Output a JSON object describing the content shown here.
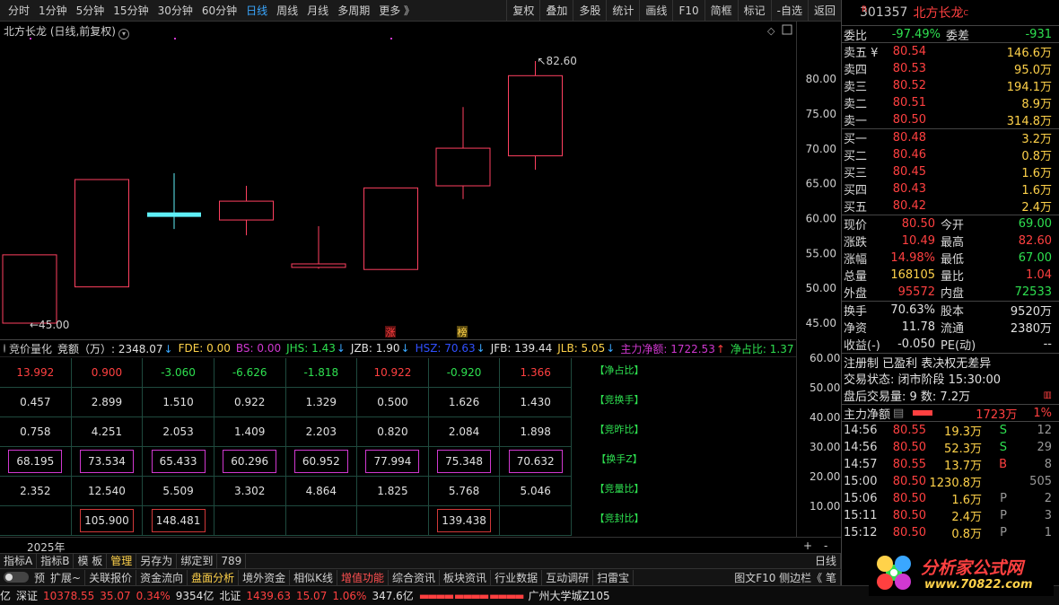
{
  "toolbar": {
    "periods": [
      "分时",
      "1分钟",
      "5分钟",
      "15分钟",
      "30分钟",
      "60分钟",
      "日线",
      "周线",
      "月线",
      "多周期",
      "更多 》"
    ],
    "active_period": "日线",
    "actions": [
      "复权",
      "叠加",
      "多股",
      "统计",
      "画线",
      "F10",
      "简框",
      "标记",
      "-自选",
      "返回"
    ]
  },
  "chart": {
    "title": "北方长龙 (日线,前复权)",
    "high_label": "82.60",
    "low_label": "45.00",
    "price_ticks": [
      "80.00",
      "75.00",
      "70.00",
      "65.00",
      "60.00",
      "55.00",
      "50.00",
      "45.00"
    ],
    "candles": [
      {
        "open": 45.0,
        "close": 54.8,
        "high": 54.8,
        "low": 45.0
      },
      {
        "open": 50.2,
        "close": 65.6,
        "high": 65.6,
        "low": 50.2
      },
      {
        "open": 60.5,
        "close": 60.5,
        "high": 66.5,
        "low": 58.5,
        "kind": "doji"
      },
      {
        "open": 59.8,
        "close": 62.5,
        "high": 64.7,
        "low": 57.6
      },
      {
        "open": 53.0,
        "close": 53.5,
        "high": 58.9,
        "low": 52.8
      },
      {
        "open": 52.7,
        "close": 64.4,
        "high": 64.4,
        "low": 52.7
      },
      {
        "open": 64.7,
        "close": 70.1,
        "high": 76.0,
        "low": 62.8
      },
      {
        "open": 69.0,
        "close": 80.5,
        "high": 82.6,
        "low": 67.0
      }
    ],
    "markers": [
      "涨",
      "榜"
    ]
  },
  "indicator": {
    "name": "竞价量化",
    "fields": [
      {
        "label": "竞额（万）: 2348.07",
        "color": "#e0e0e0",
        "arrow": "↓"
      },
      {
        "label": "FDE: 0.00",
        "color": "#ffd24a",
        "arrow": ""
      },
      {
        "label": "BS: 0.00",
        "color": "#d038d0",
        "arrow": ""
      },
      {
        "label": "JHS: 1.43",
        "color": "#2ee050",
        "arrow": "↓"
      },
      {
        "label": "JZB: 1.90",
        "color": "#e0e0e0",
        "arrow": "↓"
      },
      {
        "label": "HSZ: 70.63",
        "color": "#3050ff",
        "arrow": "↓"
      },
      {
        "label": "JFB: 139.44",
        "color": "#e0e0e0",
        "arrow": ""
      },
      {
        "label": "JLB: 5.05",
        "color": "#ffd24a",
        "arrow": "↓"
      },
      {
        "label": "主力净额: 1722.53",
        "color": "#d038d0",
        "arrow": "↑"
      },
      {
        "label": "净占比: 1.37",
        "color": "#2ee050",
        "arrow": "↑"
      }
    ],
    "rows": [
      {
        "label": "【净占比】",
        "values": [
          "13.992",
          "0.900",
          "-3.060",
          "-6.626",
          "-1.818",
          "10.922",
          "-0.920",
          "1.366"
        ],
        "colors": [
          "up",
          "up",
          "dn",
          "dn",
          "dn",
          "up",
          "dn",
          "up"
        ]
      },
      {
        "label": "【竞换手】",
        "values": [
          "0.457",
          "2.899",
          "1.510",
          "0.922",
          "1.329",
          "0.500",
          "1.626",
          "1.430"
        ]
      },
      {
        "label": "【竞昨比】",
        "values": [
          "0.758",
          "4.251",
          "2.053",
          "1.409",
          "2.203",
          "0.820",
          "2.084",
          "1.898"
        ]
      },
      {
        "label": "【换手Z】",
        "values": [
          "68.195",
          "73.534",
          "65.433",
          "60.296",
          "60.952",
          "77.994",
          "75.348",
          "70.632"
        ],
        "box": "m"
      },
      {
        "label": "【竞量比】",
        "values": [
          "2.352",
          "12.540",
          "5.509",
          "3.302",
          "4.864",
          "1.825",
          "5.768",
          "5.046"
        ]
      },
      {
        "label": "【竞封比】",
        "values": [
          "",
          "105.900",
          "148.481",
          "",
          "",
          "",
          "139.438",
          ""
        ],
        "box": "r"
      }
    ],
    "y_ticks": [
      "60.00",
      "50.00",
      "40.00",
      "30.00",
      "20.00",
      "10.00"
    ]
  },
  "axis": {
    "year": "2025年",
    "plus": "+",
    "minus": "-",
    "period": "日线"
  },
  "tabs1": [
    "指标A",
    "指标B",
    "模 板",
    "管理",
    "另存为",
    "绑定到",
    "789"
  ],
  "tabs1_active": "管理",
  "tabs2": [
    "扩展~",
    "关联报价",
    "资金流向",
    "盘面分析",
    "境外资金",
    "相似K线",
    "增值功能",
    "综合资讯",
    "板块资讯",
    "行业数据",
    "互动调研",
    "扫雷宝"
  ],
  "tabs2_right": "图文F10 侧边栏《  笔",
  "toggle_label": "预",
  "status": {
    "prefix": "亿",
    "sz": {
      "name": "深证",
      "value": "10378.55",
      "chg": "35.07",
      "pct": "0.34%",
      "amt": "9354亿"
    },
    "bz": {
      "name": "北证",
      "value": "1439.63",
      "chg": "15.07",
      "pct": "1.06%",
      "amt": "347.6亿"
    },
    "marquee": "广州大学城Z105"
  },
  "quote": {
    "mark": "R",
    "code": "301357",
    "name": "北方长龙",
    "suffix": "C",
    "weibi": {
      "label": "委比",
      "value": "-97.49%",
      "label2": "委差",
      "value2": "-931"
    },
    "asks": [
      {
        "label": "卖五 ¥",
        "price": "80.54",
        "vol": "146.6万"
      },
      {
        "label": "卖四",
        "price": "80.53",
        "vol": "95.0万"
      },
      {
        "label": "卖三",
        "price": "80.52",
        "vol": "194.1万"
      },
      {
        "label": "卖二",
        "price": "80.51",
        "vol": "8.9万"
      },
      {
        "label": "卖一",
        "price": "80.50",
        "vol": "314.8万"
      }
    ],
    "bids": [
      {
        "label": "买一",
        "price": "80.48",
        "vol": "3.2万"
      },
      {
        "label": "买二",
        "price": "80.46",
        "vol": "0.8万"
      },
      {
        "label": "买三",
        "price": "80.45",
        "vol": "1.6万"
      },
      {
        "label": "买四",
        "price": "80.43",
        "vol": "1.6万"
      },
      {
        "label": "买五",
        "price": "80.42",
        "vol": "2.4万"
      }
    ],
    "stats": [
      {
        "l1": "现价",
        "v1": "80.50",
        "c1": "up",
        "l2": "今开",
        "v2": "69.00",
        "c2": "dn"
      },
      {
        "l1": "涨跌",
        "v1": "10.49",
        "c1": "up",
        "l2": "最高",
        "v2": "82.60",
        "c2": "up"
      },
      {
        "l1": "涨幅",
        "v1": "14.98%",
        "c1": "up",
        "l2": "最低",
        "v2": "67.00",
        "c2": "dn"
      },
      {
        "l1": "总量",
        "v1": "168105",
        "c1": "yw",
        "l2": "量比",
        "v2": "1.04",
        "c2": "up"
      },
      {
        "l1": "外盘",
        "v1": "95572",
        "c1": "up",
        "l2": "内盘",
        "v2": "72533",
        "c2": "dn"
      }
    ],
    "stats2": [
      {
        "l1": "换手",
        "v1": "70.63%",
        "l2": "股本",
        "v2": "9520万"
      },
      {
        "l1": "净资",
        "v1": "11.78",
        "l2": "流通",
        "v2": "2380万"
      },
      {
        "l1": "收益(-)",
        "v1": "-0.050",
        "l2": "PE(动)",
        "v2": "--"
      }
    ],
    "tags": "注册制 已盈利 表决权无差异",
    "trade_status": "交易状态: 闭市阶段 15:30:00",
    "after_hours": "盘后交易量: 9   数: 7.2万",
    "main_net": {
      "label": "主力净额",
      "value": "1723万",
      "pct": "1%"
    },
    "ticks": [
      {
        "t": "14:56",
        "p": "80.55",
        "v": "19.3万",
        "f": "S",
        "n": "12"
      },
      {
        "t": "14:56",
        "p": "80.50",
        "v": "52.3万",
        "f": "S",
        "n": "29"
      },
      {
        "t": "14:57",
        "p": "80.55",
        "v": "13.7万",
        "f": "B",
        "n": "8"
      },
      {
        "t": "15:00",
        "p": "80.50",
        "v": "1230.8万",
        "f": "",
        "n": "505"
      },
      {
        "t": "15:06",
        "p": "80.50",
        "v": "1.6万",
        "f": "P",
        "n": "2"
      },
      {
        "t": "15:11",
        "p": "80.50",
        "v": "2.4万",
        "f": "P",
        "n": "3"
      },
      {
        "t": "15:12",
        "p": "80.50",
        "v": "0.8万",
        "f": "P",
        "n": "1"
      }
    ]
  },
  "logo": {
    "title": "分析家公式网",
    "url": "www.70822.com"
  }
}
